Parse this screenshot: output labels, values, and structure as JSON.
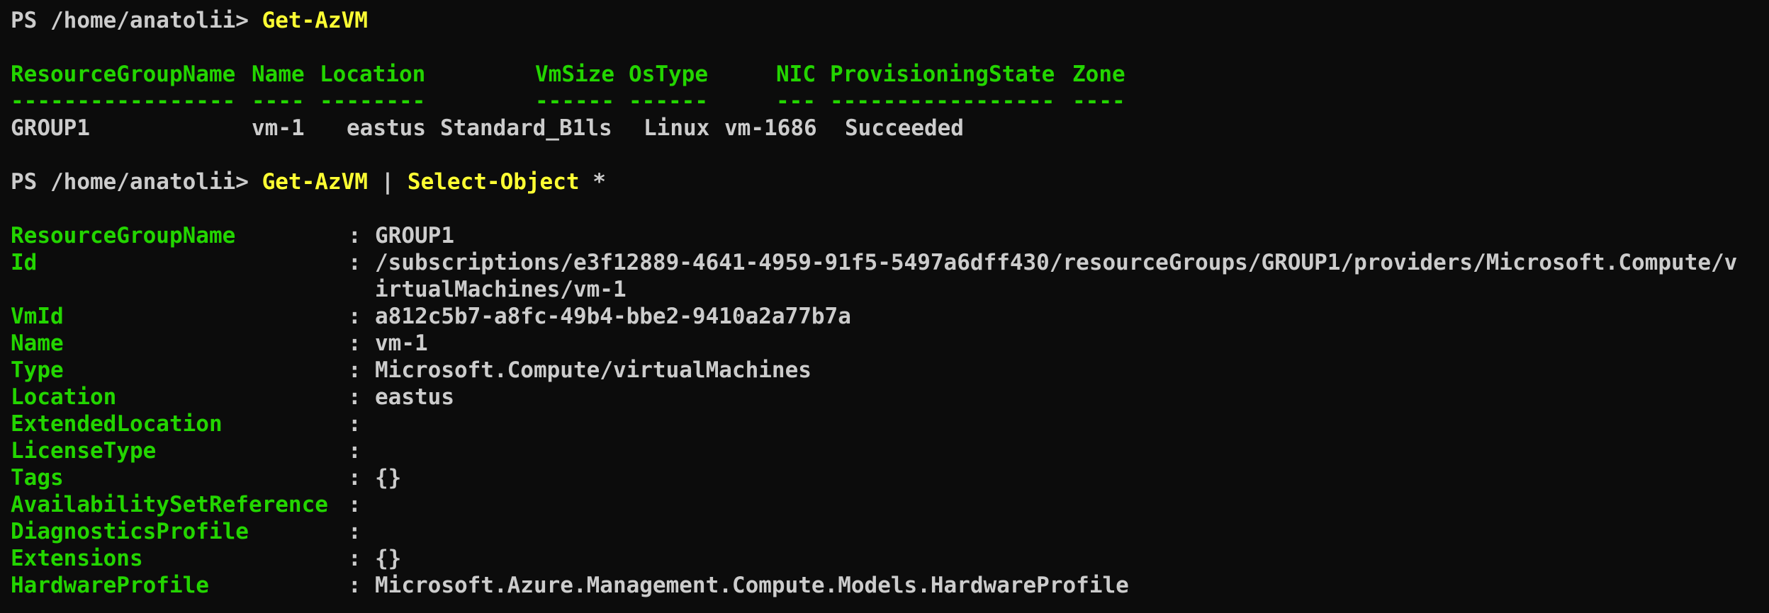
{
  "session": {
    "prompt": "PS /home/anatolii> ",
    "commands": [
      {
        "name": "Get-AzVM"
      },
      {
        "name": "Get-AzVM",
        "pipe": " | ",
        "name2": "Select-Object",
        "arg": " *"
      }
    ]
  },
  "table": {
    "headers": [
      "ResourceGroupName",
      "Name",
      "Location",
      "VmSize",
      "OsType",
      "NIC",
      "ProvisioningState",
      "Zone"
    ],
    "dashes": [
      "-----------------",
      "----",
      "--------",
      "------",
      "------",
      "---",
      "-----------------",
      "----"
    ],
    "row": [
      "GROUP1",
      "vm-1",
      "eastus",
      "Standard_B1ls",
      "Linux",
      "vm-1686",
      "Succeeded",
      ""
    ]
  },
  "props": [
    {
      "key": "ResourceGroupName",
      "value": "GROUP1"
    },
    {
      "key": "Id",
      "value": "/subscriptions/e3f12889-4641-4959-91f5-5497a6dff430/resourceGroups/GROUP1/providers/Microsoft.Compute/v",
      "cont": "irtualMachines/vm-1"
    },
    {
      "key": "VmId",
      "value": "a812c5b7-a8fc-49b4-bbe2-9410a2a77b7a"
    },
    {
      "key": "Name",
      "value": "vm-1"
    },
    {
      "key": "Type",
      "value": "Microsoft.Compute/virtualMachines"
    },
    {
      "key": "Location",
      "value": "eastus"
    },
    {
      "key": "ExtendedLocation",
      "value": ""
    },
    {
      "key": "LicenseType",
      "value": ""
    },
    {
      "key": "Tags",
      "value": "{}"
    },
    {
      "key": "AvailabilitySetReference",
      "value": ""
    },
    {
      "key": "DiagnosticsProfile",
      "value": ""
    },
    {
      "key": "Extensions",
      "value": "{}"
    },
    {
      "key": "HardwareProfile",
      "value": "Microsoft.Azure.Management.Compute.Models.HardwareProfile"
    }
  ],
  "separator": ":",
  "colors": {
    "background": "#0c0c0c",
    "text": "#cccccc",
    "command": "#ffff33",
    "header": "#23d500"
  }
}
